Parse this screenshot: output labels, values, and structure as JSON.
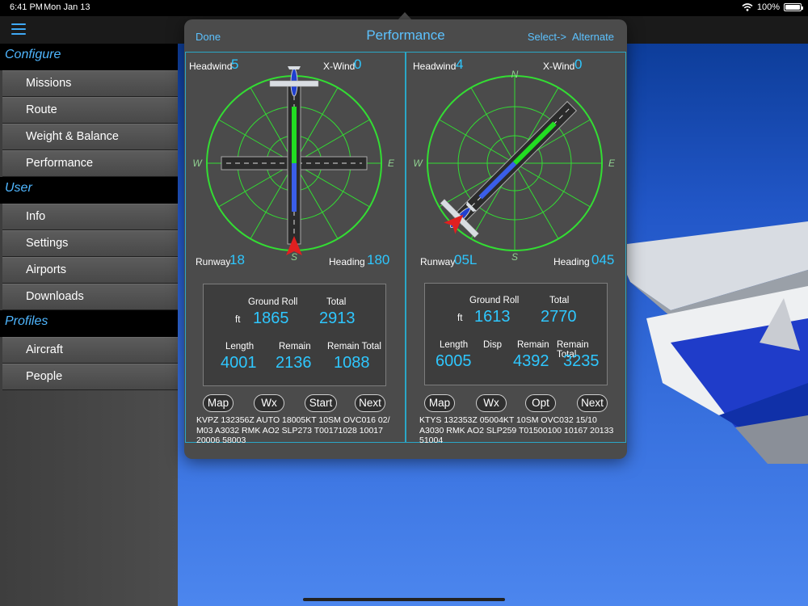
{
  "status": {
    "time": "6:41 PM",
    "date": "Mon Jan 13",
    "battery": "100%",
    "battery_level": 1.0
  },
  "sidebar": {
    "sections": [
      {
        "title": "Configure",
        "items": [
          "Missions",
          "Route",
          "Weight & Balance",
          "Performance"
        ]
      },
      {
        "title": "User",
        "items": [
          "Info",
          "Settings",
          "Airports",
          "Downloads"
        ]
      },
      {
        "title": "Profiles",
        "items": [
          "Aircraft",
          "People"
        ]
      }
    ]
  },
  "popover": {
    "done": "Done",
    "title": "Performance",
    "select": "Select->",
    "alternate": "Alternate"
  },
  "left": {
    "headwind_label": "Headwind",
    "headwind": "5",
    "xwind_label": "X-Wind",
    "xwind": "0",
    "compass": {
      "N": "",
      "S": "S",
      "E": "E",
      "W": "W"
    },
    "runway_label": "Runway",
    "runway": "18",
    "heading_label": "Heading",
    "heading": "180",
    "perf": {
      "ground_roll_label": "Ground Roll",
      "total_label": "Total",
      "unit": "ft",
      "ground_roll": "1865",
      "total": "2913",
      "length_label": "Length",
      "remain_label": "Remain",
      "remain_total_label": "Remain Total",
      "length": "4001",
      "remain": "2136",
      "remain_total": "1088"
    },
    "buttons": [
      "Map",
      "Wx",
      "Start",
      "Next"
    ],
    "metar": "KVPZ 132356Z AUTO 18005KT 10SM OVC016 02/\nM03 A3032 RMK AO2 SLP273 T00171028 10017\n20006 58003"
  },
  "right": {
    "headwind_label": "Headwind",
    "headwind": "4",
    "xwind_label": "X-Wind",
    "xwind": "0",
    "compass": {
      "N": "N",
      "S": "S",
      "E": "E",
      "W": "W"
    },
    "runway_label": "Runway",
    "runway": "05L",
    "heading_label": "Heading",
    "heading": "045",
    "perf": {
      "ground_roll_label": "Ground Roll",
      "total_label": "Total",
      "unit": "ft",
      "ground_roll": "1613",
      "total": "2770",
      "length_label": "Length",
      "disp_label": "Disp",
      "remain_label": "Remain",
      "remain_total_label": "Remain Total",
      "length": "6005",
      "remain": "4392",
      "remain_total": "3235"
    },
    "buttons": [
      "Map",
      "Wx",
      "Opt",
      "Next"
    ],
    "metar": "KTYS 132353Z 05004KT 10SM OVC032 15/10\nA3030 RMK AO2 SLP259 T01500100 10167 20133\n51004"
  },
  "colors": {
    "accent": "#5cc2ff",
    "value": "#2ec7ff",
    "compass": "#33dd33",
    "wind_arrow": "#e02020",
    "runway": "#2b2b2b"
  }
}
